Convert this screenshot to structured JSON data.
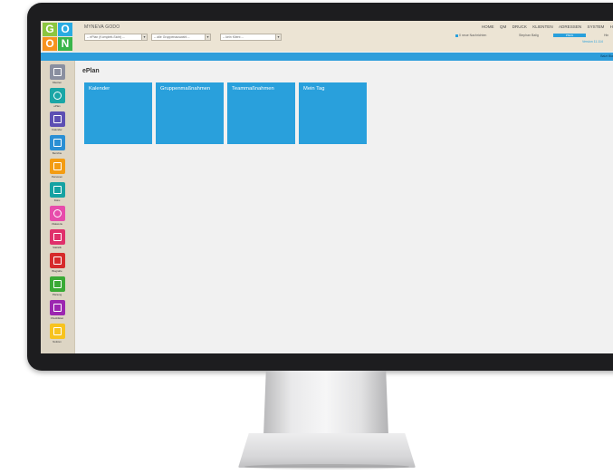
{
  "app": {
    "title": "MYNEVA GODO",
    "logo_letters": [
      "G",
      "O",
      "O",
      "N"
    ]
  },
  "toolbar": {
    "selects": [
      {
        "value": "-- ePlan (Komplett-Sicht) --"
      },
      {
        "value": "-- alle Gruppenauswahl --"
      },
      {
        "value": "-- kein Klient --"
      }
    ]
  },
  "nav": {
    "items": [
      "HOME",
      "QM",
      "DRUCK",
      "KLIENTEN",
      "ADRESSEN",
      "SYSTEM",
      "H"
    ],
    "status_text": "0 neue Nachrichten",
    "user_status": "Stephan Balig",
    "message_label": "Pflicht",
    "version_text": "Version 11.114",
    "other_label": "Hin"
  },
  "bluebar": {
    "user_text": "Balzt Bla"
  },
  "sidebar": {
    "items": [
      {
        "label": "Klienten",
        "icon": "people-icon",
        "color": "#8a8fa0"
      },
      {
        "label": "ePlan",
        "icon": "ring-icon",
        "color": "#1aa6a6"
      },
      {
        "label": "Kalender",
        "icon": "calendar-icon",
        "color": "#5d4fb3"
      },
      {
        "label": "Berichte",
        "icon": "document-icon",
        "color": "#2b8fd4"
      },
      {
        "label": "Personen",
        "icon": "person-icon",
        "color": "#f39c12"
      },
      {
        "label": "Doku",
        "icon": "file-icon",
        "color": "#16a2a2"
      },
      {
        "label": "Vitalwerte",
        "icon": "target-icon",
        "color": "#e74cab"
      },
      {
        "label": "Statistik",
        "icon": "chart-icon",
        "color": "#e0306b"
      },
      {
        "label": "Biografie",
        "icon": "book-icon",
        "color": "#d62b2b"
      },
      {
        "label": "Planung",
        "icon": "calendar-grid-icon",
        "color": "#3aaa35"
      },
      {
        "label": "Checklisten",
        "icon": "check-icon",
        "color": "#9c27b0"
      },
      {
        "label": "Notizen",
        "icon": "pencil-icon",
        "color": "#f7c31e"
      }
    ]
  },
  "main": {
    "title": "ePlan",
    "tiles": [
      {
        "label": "Kalender"
      },
      {
        "label": "Gruppenmaßnahmen"
      },
      {
        "label": "Teammaßnahmen"
      },
      {
        "label": "Mein Tag"
      }
    ]
  }
}
